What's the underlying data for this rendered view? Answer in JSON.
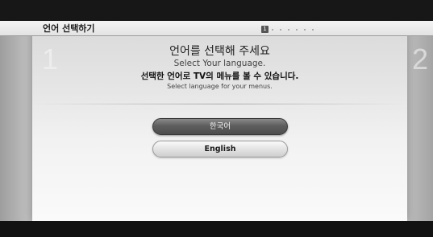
{
  "header": {
    "title": "언어 선택하기",
    "current_step": "1",
    "remaining_step_dots": 6
  },
  "steps": {
    "current_number": "1",
    "next_number": "2"
  },
  "instructions": {
    "heading_ko": "언어를 선택해 주세요",
    "heading_en": "Select Your language.",
    "subtext_ko": "선택한 언어로 TV의 메뉴를 볼 수 있습니다.",
    "subtext_en": "Select language for your menus."
  },
  "languages": [
    {
      "label": "한국어",
      "selected": true
    },
    {
      "label": "English",
      "selected": false
    }
  ]
}
